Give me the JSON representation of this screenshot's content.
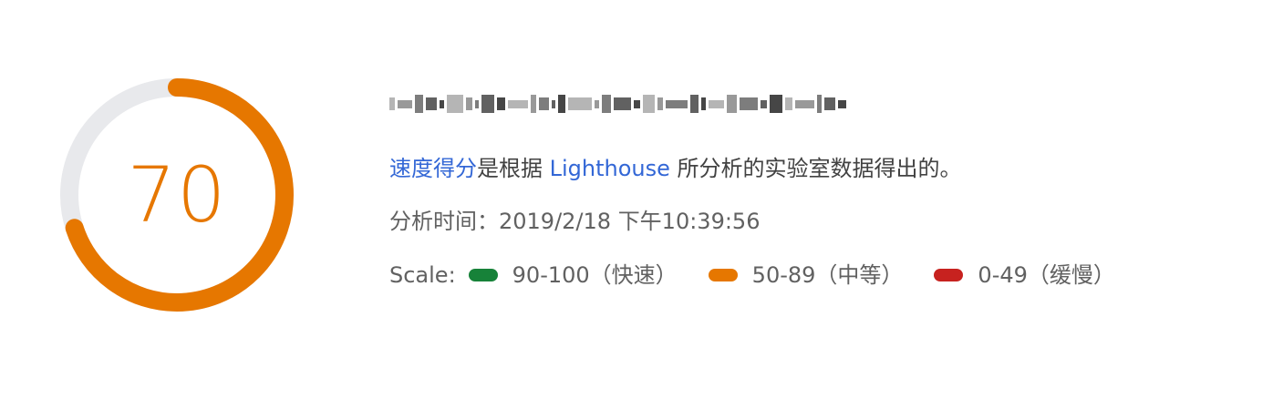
{
  "gauge": {
    "score": "70",
    "fraction": 0.7,
    "color": "#e67700",
    "track_color": "#e8e9ec"
  },
  "url": {
    "text": "https://example.com/page",
    "blurred": true
  },
  "description": {
    "link1": "速度得分",
    "middle": "是根据 ",
    "link2": "Lighthouse",
    "tail": " 所分析的实验室数据得出的。"
  },
  "analysis_time": {
    "label": "分析时间：",
    "value": "2019/2/18 下午10:39:56"
  },
  "scale": {
    "label": "Scale:",
    "items": [
      {
        "range": "90-100（快速）",
        "color": "#178239",
        "icon": "green-pill-icon"
      },
      {
        "range": "50-89（中等）",
        "color": "#e67700",
        "icon": "orange-pill-icon"
      },
      {
        "range": "0-49（缓慢）",
        "color": "#c7221f",
        "icon": "red-pill-icon"
      }
    ]
  }
}
